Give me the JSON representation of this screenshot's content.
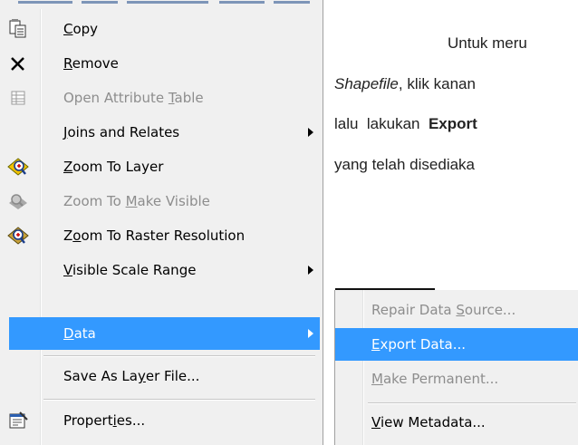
{
  "context_menu": {
    "items": [
      {
        "key": "copy",
        "pre": "",
        "ul": "C",
        "post": "opy",
        "icon": "copy-icon",
        "disabled": false,
        "submenu": false
      },
      {
        "key": "remove",
        "pre": "",
        "ul": "R",
        "post": "emove",
        "icon": "remove-icon",
        "disabled": false,
        "submenu": false
      },
      {
        "key": "open-attribute-table",
        "pre": "Open Attribute ",
        "ul": "T",
        "post": "able",
        "icon": "table-icon",
        "disabled": true,
        "submenu": false
      },
      {
        "key": "joins-and-relates",
        "pre": "",
        "ul": "J",
        "post": "oins and Relates",
        "icon": "",
        "disabled": false,
        "submenu": true
      },
      {
        "key": "zoom-to-layer",
        "pre": "",
        "ul": "Z",
        "post": "oom To Layer",
        "icon": "zoom-layer-icon",
        "disabled": false,
        "submenu": false
      },
      {
        "key": "zoom-to-make-visible",
        "pre": "Zoom To ",
        "ul": "M",
        "post": "ake Visible",
        "icon": "zoom-visible-icon",
        "disabled": true,
        "submenu": false
      },
      {
        "key": "zoom-to-raster-resolution",
        "pre": "Z",
        "ul": "o",
        "post": "om To Raster Resolution",
        "icon": "zoom-raster-icon",
        "disabled": false,
        "submenu": false
      },
      {
        "key": "visible-scale-range",
        "pre": "",
        "ul": "V",
        "post": "isible Scale Range",
        "icon": "",
        "disabled": false,
        "submenu": true
      },
      {
        "key": "data",
        "pre": "",
        "ul": "D",
        "post": "ata",
        "icon": "",
        "disabled": false,
        "submenu": true,
        "selected": true
      },
      {
        "key": "save-as-layer-file",
        "pre": "Save As La",
        "ul": "y",
        "post": "er File...",
        "icon": "",
        "disabled": false,
        "submenu": false
      },
      {
        "key": "properties",
        "pre": "Propert",
        "ul": "i",
        "post": "es...",
        "icon": "properties-icon",
        "disabled": false,
        "submenu": false
      }
    ]
  },
  "data_submenu": {
    "items": [
      {
        "key": "repair-data-source",
        "pre": "Repair Data ",
        "ul": "S",
        "post": "ource...",
        "disabled": true
      },
      {
        "key": "export-data",
        "pre": "",
        "ul": "E",
        "post": "xport Data...",
        "disabled": false,
        "selected": true
      },
      {
        "key": "make-permanent",
        "pre": "",
        "ul": "M",
        "post": "ake Permanent...",
        "disabled": true
      },
      {
        "key": "view-metadata",
        "pre": "",
        "ul": "V",
        "post": "iew Metadata...",
        "disabled": false
      }
    ]
  },
  "document": {
    "line1": "Untuk meru",
    "line2_italic": "Shapefile",
    "line2_rest": ", klik kanan",
    "line3_pre": "lalu  lakukan  ",
    "line3_bold": "Export",
    "line4": "yang telah disediaka"
  },
  "colors": {
    "menu_bg": "#f0f0f0",
    "selection": "#3399ff",
    "disabled_text": "#8d8d8d"
  }
}
